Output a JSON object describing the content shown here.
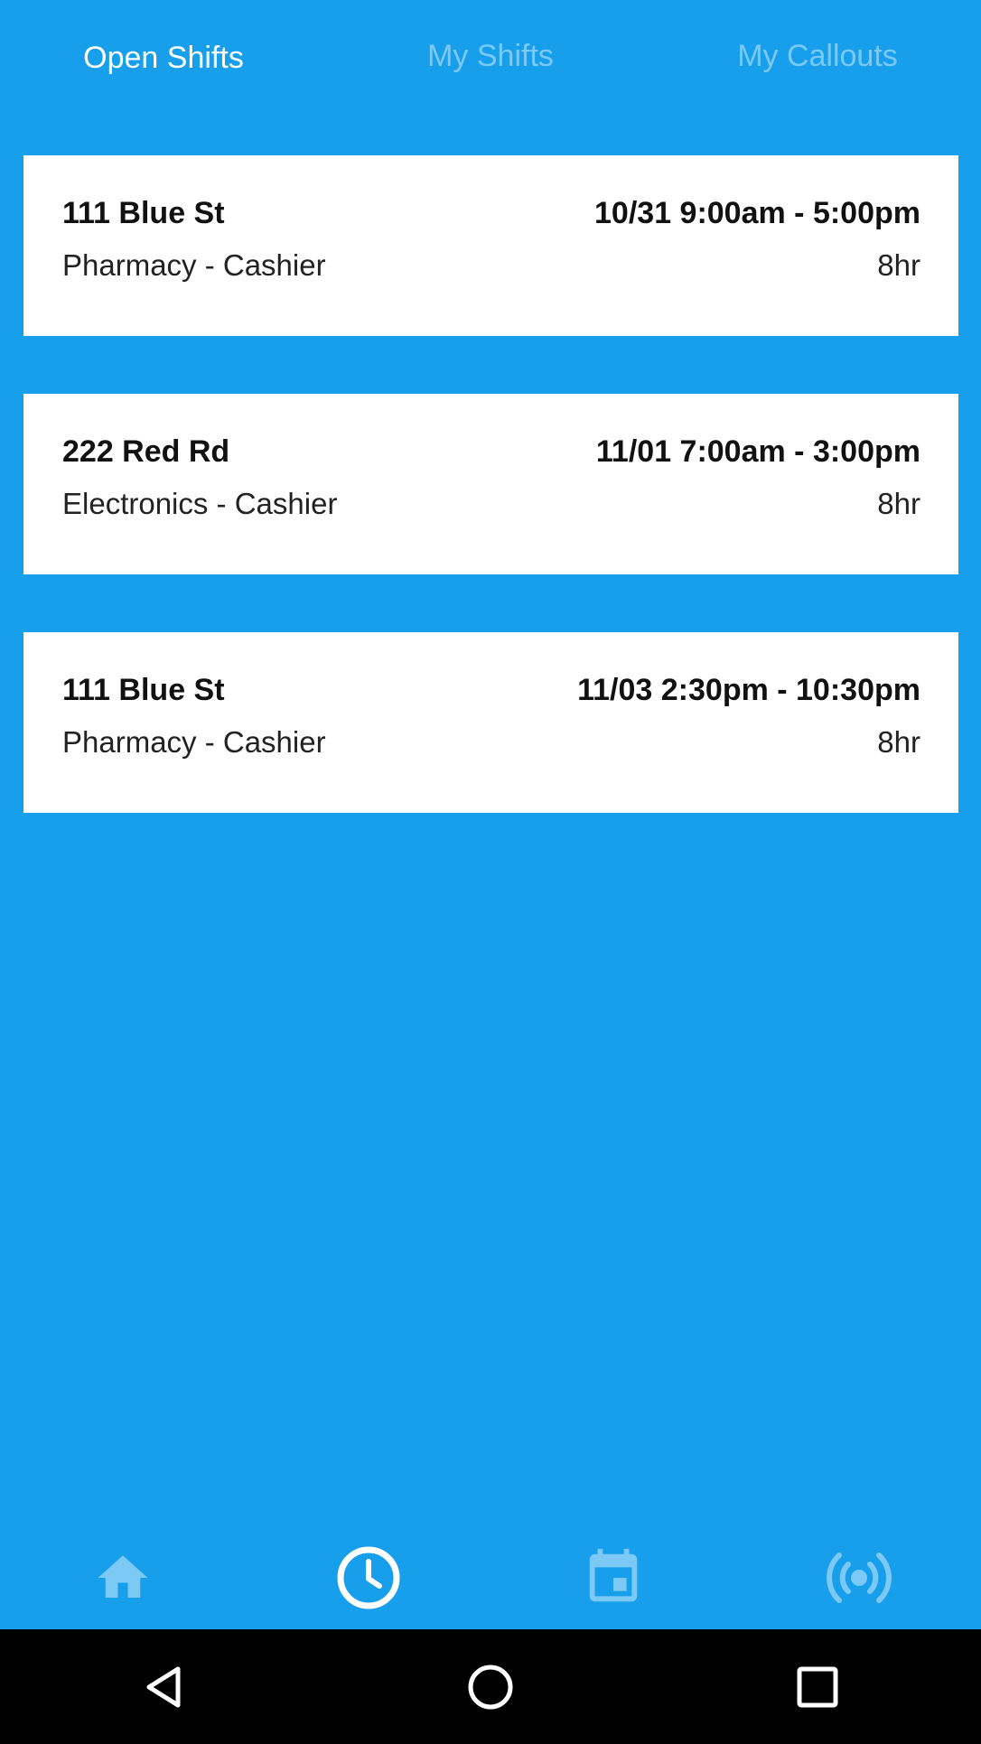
{
  "colors": {
    "background": "#189fec",
    "tab_active": "#ffffff",
    "tab_inactive": "#7cc9f5",
    "nav_active": "#ffffff",
    "nav_inactive": "#7cc9f5",
    "card": "#ffffff",
    "system_bar": "#000000"
  },
  "tabs": [
    {
      "label": "Open Shifts",
      "active": true
    },
    {
      "label": "My Shifts",
      "active": false
    },
    {
      "label": "My Callouts",
      "active": false
    }
  ],
  "shifts": [
    {
      "location": "111 Blue St",
      "datetime": "10/31 9:00am - 5:00pm",
      "role": "Pharmacy - Cashier",
      "hours": "8hr"
    },
    {
      "location": "222 Red Rd",
      "datetime": "11/01 7:00am - 3:00pm",
      "role": "Electronics - Cashier",
      "hours": "8hr"
    },
    {
      "location": "111 Blue St",
      "datetime": "11/03 2:30pm - 10:30pm",
      "role": "Pharmacy - Cashier",
      "hours": "8hr"
    }
  ],
  "bottom_nav": [
    {
      "icon": "home-icon",
      "active": false
    },
    {
      "icon": "clock-icon",
      "active": true
    },
    {
      "icon": "calendar-icon",
      "active": false
    },
    {
      "icon": "broadcast-icon",
      "active": false
    }
  ],
  "system_nav": [
    {
      "icon": "back-icon"
    },
    {
      "icon": "home-circle-icon"
    },
    {
      "icon": "recent-apps-icon"
    }
  ]
}
